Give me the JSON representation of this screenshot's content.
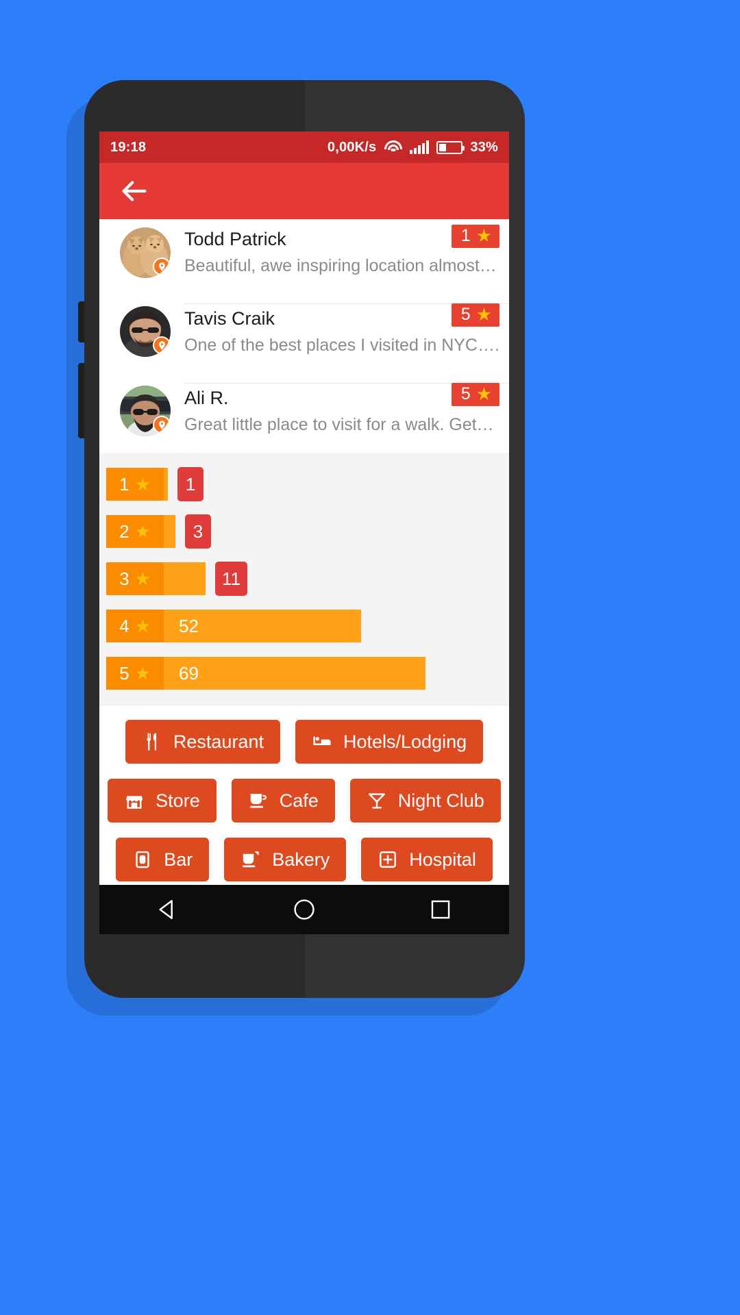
{
  "status_bar": {
    "time": "19:18",
    "net_speed": "0,00K/s",
    "wifi_icon": "wifi-icon",
    "signal_icon": "signal-bars-icon",
    "battery_icon": "battery-icon",
    "battery_percent": "33%",
    "battery_level": 33,
    "background_color": "#C62828"
  },
  "app_bar": {
    "back_icon": "back-arrow-icon",
    "background_color": "#E53935"
  },
  "reviews": [
    {
      "name": "Todd Patrick",
      "text": "Beautiful, awe inspiring location almost…",
      "rating": "1",
      "star_icon": "star-icon",
      "avatar_icon": "avatar-image",
      "source_badge_icon": "google-maps-badge-icon"
    },
    {
      "name": "Tavis Craik",
      "text": "One of the best places I visited in NYC….",
      "rating": "5",
      "star_icon": "star-icon",
      "avatar_icon": "avatar-image",
      "source_badge_icon": "google-maps-badge-icon"
    },
    {
      "name": "Ali R.",
      "text": "Great little place to visit for a walk. Get…",
      "rating": "5",
      "star_icon": "star-icon",
      "avatar_icon": "avatar-image",
      "source_badge_icon": "google-maps-badge-icon"
    }
  ],
  "chart_data": {
    "type": "bar",
    "title": "",
    "xlabel": "",
    "ylabel": "",
    "orientation": "horizontal",
    "categories": [
      "1",
      "2",
      "3",
      "4",
      "5"
    ],
    "values": [
      1,
      3,
      11,
      52,
      69
    ],
    "value_labels": [
      "1",
      "3",
      "11",
      "52",
      "69"
    ],
    "category_suffix_icon": "star-icon",
    "xlim": [
      0,
      69
    ],
    "grid": false,
    "legend": null,
    "bar_color": "#FFA117",
    "label_chip_color": "#FB8C00",
    "count_badge_color": "#E03C3C",
    "background_color": "#f4f4f4",
    "count_inside_bar": [
      false,
      false,
      false,
      true,
      true
    ]
  },
  "categories": {
    "button_color": "#DD4A20",
    "rows": [
      [
        {
          "label": "Restaurant",
          "icon": "restaurant-icon"
        },
        {
          "label": "Hotels/Lodging",
          "icon": "hotel-bed-icon"
        }
      ],
      [
        {
          "label": "Store",
          "icon": "store-icon"
        },
        {
          "label": "Cafe",
          "icon": "coffee-cup-icon"
        },
        {
          "label": "Night Club",
          "icon": "cocktail-glass-icon"
        }
      ],
      [
        {
          "label": "Bar",
          "icon": "drink-cup-icon"
        },
        {
          "label": "Bakery",
          "icon": "bakery-cup-icon"
        },
        {
          "label": "Hospital",
          "icon": "hospital-cross-icon"
        }
      ]
    ]
  },
  "nav_bar": {
    "back_icon": "nav-back-triangle-icon",
    "home_icon": "nav-home-circle-icon",
    "recents_icon": "nav-recents-square-icon"
  }
}
